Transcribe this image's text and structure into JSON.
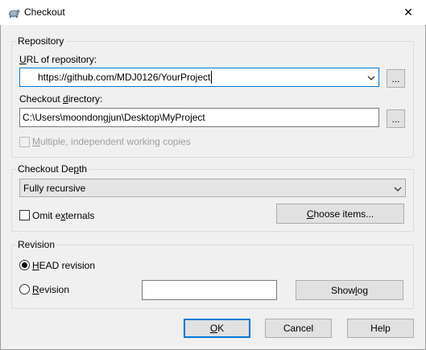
{
  "window": {
    "title": "Checkout",
    "close_glyph": "✕"
  },
  "repository": {
    "group_label": "Repository",
    "url_label": {
      "pre": "",
      "mnemonic": "U",
      "post": "RL of repository:"
    },
    "url_value": "https://github.com/MDJ0126/YourProject",
    "url_browse": "...",
    "dir_label": {
      "pre": "Checkout ",
      "mnemonic": "d",
      "post": "irectory:"
    },
    "dir_value": "C:\\Users\\moondongjun\\Desktop\\MyProject",
    "dir_browse": "...",
    "multiple_label": {
      "pre": "",
      "mnemonic": "M",
      "post": "ultiple, independent working copies"
    },
    "multiple_checked": false,
    "multiple_enabled": false
  },
  "depth": {
    "group_label": {
      "pre": "Checkout De",
      "mnemonic": "p",
      "post": "th"
    },
    "selected": "Fully recursive",
    "omit_label": {
      "pre": "Omit e",
      "mnemonic": "x",
      "post": "ternals"
    },
    "omit_checked": false,
    "choose_label": {
      "pre": "",
      "mnemonic": "C",
      "post": "hoose items..."
    }
  },
  "revision": {
    "group_label": "Revision",
    "head_label": {
      "pre": "",
      "mnemonic": "H",
      "post": "EAD revision"
    },
    "head_selected": true,
    "rev_label": {
      "pre": "",
      "mnemonic": "R",
      "post": "evision"
    },
    "rev_value": "",
    "show_log_label": {
      "pre": "Show ",
      "mnemonic": "l",
      "post": "og"
    }
  },
  "buttons": {
    "ok": {
      "pre": "",
      "mnemonic": "O",
      "post": "K"
    },
    "cancel": "Cancel",
    "help": "Help"
  },
  "colors": {
    "accent": "#0078d7",
    "dialog_bg": "#f0f0f0"
  },
  "icons": {
    "app": "tortoisesvn-icon",
    "close": "close-icon",
    "dropdown": "chevron-down-icon"
  }
}
